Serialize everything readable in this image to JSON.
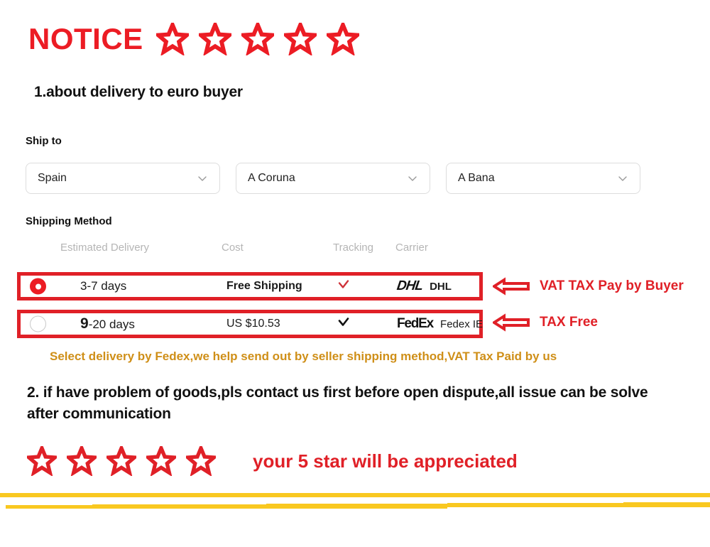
{
  "header": {
    "title": "NOTICE",
    "star_count": 5,
    "star_icon": "star-outline-icon",
    "accent_red": "#ec1c24"
  },
  "section1": {
    "heading": "1.about delivery to euro buyer"
  },
  "ship_to": {
    "label": "Ship to",
    "selects": [
      {
        "name": "country-select",
        "value": "Spain",
        "icon": "chevron-down-icon"
      },
      {
        "name": "province-select",
        "value": "A Coruna",
        "icon": "chevron-down-icon"
      },
      {
        "name": "city-select",
        "value": "A Bana",
        "icon": "chevron-down-icon"
      }
    ]
  },
  "shipping_method": {
    "label": "Shipping Method",
    "columns": [
      "Estimated Delivery",
      "Cost",
      "Tracking",
      "Carrier"
    ],
    "rows": [
      {
        "selected": true,
        "delivery_lead": "3-7 days",
        "delivery_prefix": "",
        "delivery_rest": "3-7 days",
        "cost": "Free Shipping",
        "cost_bold": true,
        "tracking_icon": "check-icon",
        "tracking_color": "#cf3339",
        "logo": "DHL",
        "carrier": "DHL",
        "annotation": "VAT TAX Pay by Buyer",
        "annotation_icon": "left-arrow-icon"
      },
      {
        "selected": false,
        "delivery_lead": "9",
        "delivery_prefix": "9",
        "delivery_rest": "-20 days",
        "cost": "US $10.53",
        "cost_bold": false,
        "tracking_icon": "check-icon",
        "tracking_color": "#111111",
        "logo": "FedEx",
        "carrier": "Fedex IE",
        "annotation": "TAX Free",
        "annotation_icon": "left-arrow-icon"
      }
    ]
  },
  "gold_note": "Select delivery by Fedex,we help send out by seller shipping method,VAT Tax Paid by us",
  "section2": {
    "text": "2. if have problem of goods,pls contact us first before open dispute,all issue can be solve after communication"
  },
  "footer": {
    "star_count": 5,
    "star_icon": "star-outline-icon",
    "text": "your 5 star will be appreciated",
    "divider_color": "#f9c820"
  }
}
